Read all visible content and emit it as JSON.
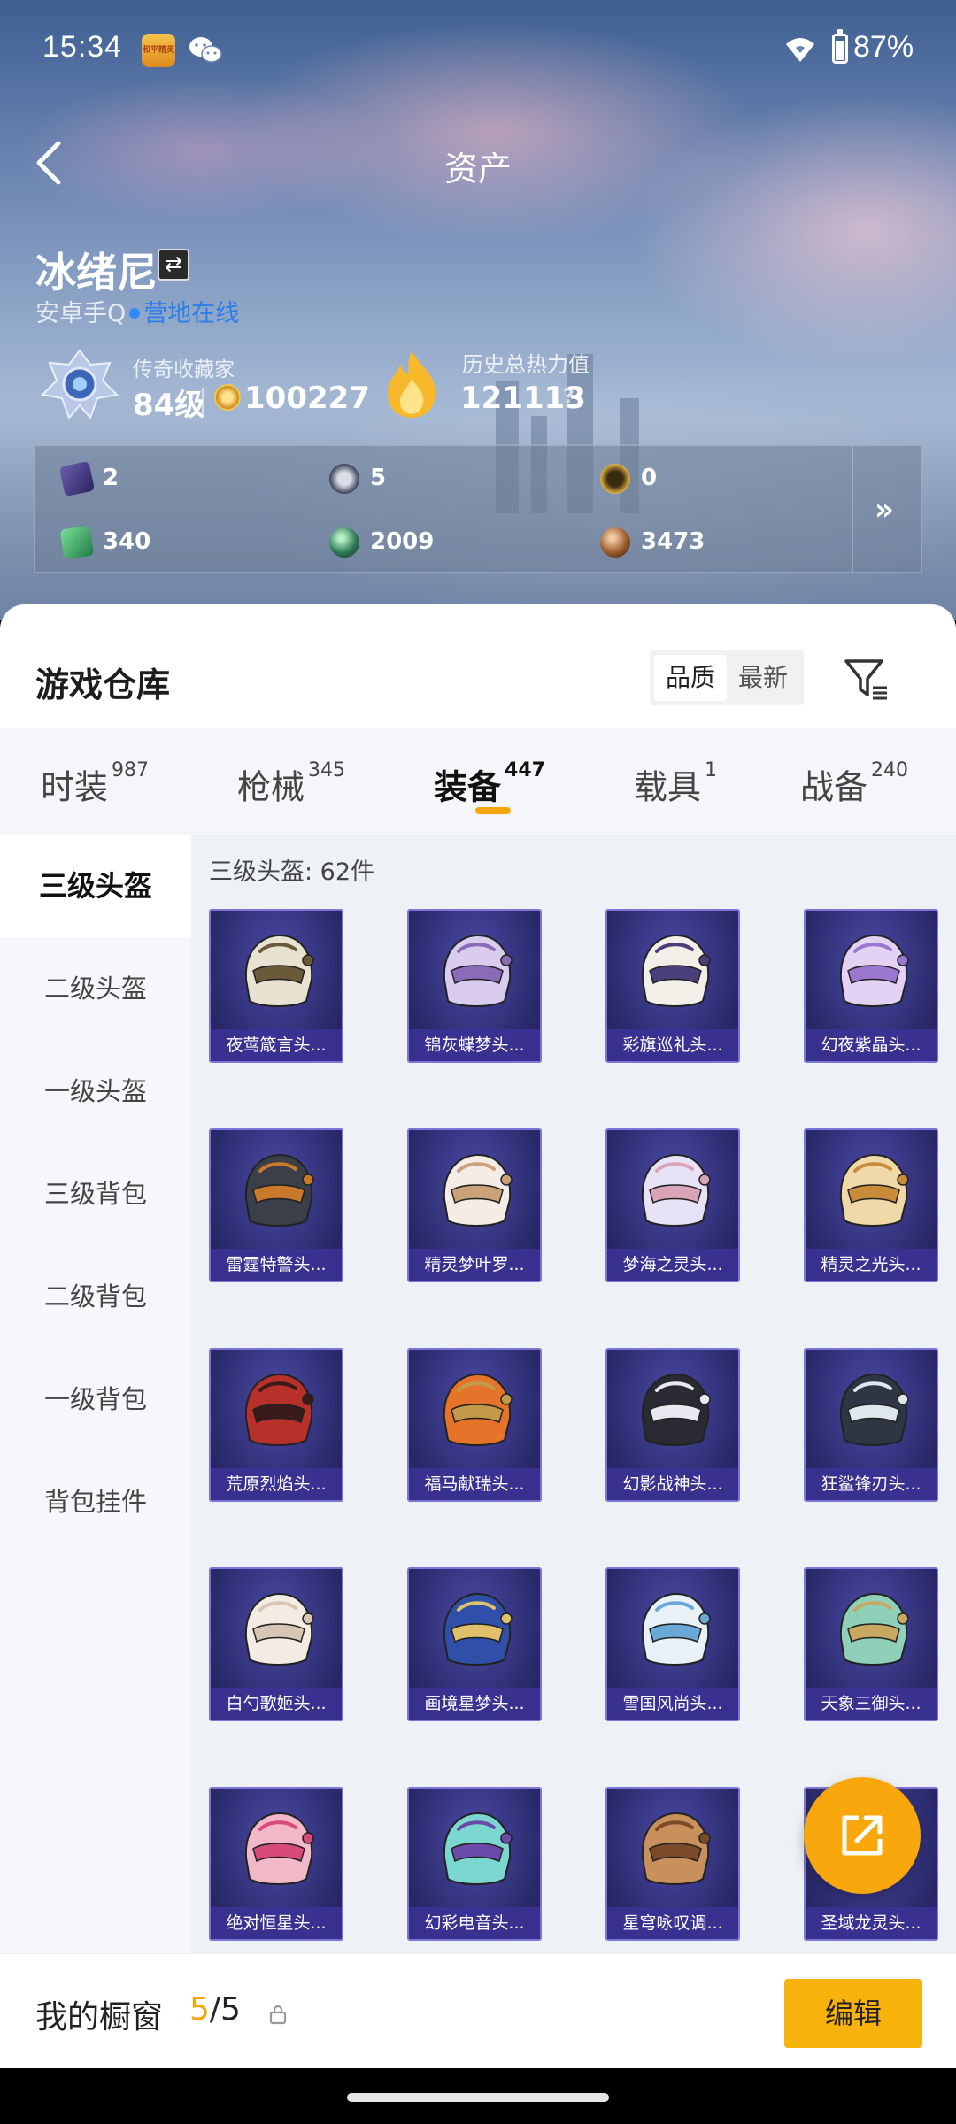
{
  "status_bar": {
    "time": "15:34",
    "battery": "87%",
    "app_badge": "和平精英"
  },
  "header": {
    "title": "资产"
  },
  "profile": {
    "name": "冰绪尼",
    "platform": "安卓手Q",
    "online_status": "营地在线",
    "collector_label": "传奇收藏家",
    "level": "84级",
    "coins": "100227",
    "heat_label": "历史总热力值",
    "heat_value": "121113",
    "help": "?"
  },
  "currencies": [
    {
      "icon": "card-icon",
      "value": "2"
    },
    {
      "icon": "medal-icon",
      "value": "5"
    },
    {
      "icon": "gold-coin-icon",
      "value": "0"
    },
    {
      "icon": "ticket-icon",
      "value": "340"
    },
    {
      "icon": "green-orb-icon",
      "value": "2009"
    },
    {
      "icon": "bronze-coin-icon",
      "value": "3473"
    }
  ],
  "warehouse": {
    "title": "游戏仓库",
    "sort_options": [
      "品质",
      "最新"
    ],
    "tabs": [
      {
        "label": "时装",
        "count": "987"
      },
      {
        "label": "枪械",
        "count": "345"
      },
      {
        "label": "装备",
        "count": "447"
      },
      {
        "label": "载具",
        "count": "1"
      },
      {
        "label": "战备",
        "count": "240"
      }
    ],
    "categories": [
      "三级头盔",
      "二级头盔",
      "一级头盔",
      "三级背包",
      "二级背包",
      "一级背包",
      "背包挂件"
    ],
    "caption": "三级头盔: 62件",
    "items": [
      {
        "name": "夜莺箴言头..."
      },
      {
        "name": "锦灰蝶梦头..."
      },
      {
        "name": "彩旗巡礼头..."
      },
      {
        "name": "幻夜紫晶头..."
      },
      {
        "name": "雷霆特警头..."
      },
      {
        "name": "精灵梦叶罗..."
      },
      {
        "name": "梦海之灵头..."
      },
      {
        "name": "精灵之光头..."
      },
      {
        "name": "荒原烈焰头..."
      },
      {
        "name": "福马献瑞头..."
      },
      {
        "name": "幻影战神头..."
      },
      {
        "name": "狂鲨锋刃头..."
      },
      {
        "name": "白勺歌姬头..."
      },
      {
        "name": "画境星梦头..."
      },
      {
        "name": "雪国风尚头..."
      },
      {
        "name": "天象三御头..."
      },
      {
        "name": "绝对恒星头..."
      },
      {
        "name": "幻彩电音头..."
      },
      {
        "name": "星穹咏叹调..."
      },
      {
        "name": "圣域龙灵头..."
      }
    ]
  },
  "showcase": {
    "label": "我的橱窗",
    "current": "5",
    "separator": "/",
    "total": "5",
    "edit_label": "编辑"
  },
  "colors": {
    "accent": "#f8b20c",
    "link": "#2c7fe8",
    "card_border": "#7d74d8"
  }
}
